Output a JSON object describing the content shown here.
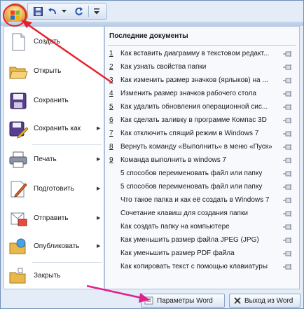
{
  "quick_access": {
    "icons": [
      "office-button-icon",
      "save-icon",
      "undo-icon",
      "redo-icon",
      "customize-dropdown-icon"
    ]
  },
  "menu": {
    "commands": [
      {
        "label": "Создать",
        "icon": "new-document-icon",
        "submenu": false
      },
      {
        "label": "Открыть",
        "icon": "open-folder-icon",
        "submenu": false
      },
      {
        "label": "Сохранить",
        "icon": "save-icon",
        "submenu": false
      },
      {
        "label": "Сохранить как",
        "icon": "save-as-icon",
        "submenu": true
      },
      {
        "label": "Печать",
        "icon": "print-icon",
        "submenu": true
      },
      {
        "label": "Подготовить",
        "icon": "prepare-icon",
        "submenu": true
      },
      {
        "label": "Отправить",
        "icon": "send-icon",
        "submenu": true
      },
      {
        "label": "Опубликовать",
        "icon": "publish-icon",
        "submenu": true
      },
      {
        "label": "Закрыть",
        "icon": "close-folder-icon",
        "submenu": false
      }
    ]
  },
  "recent": {
    "title": "Последние документы",
    "items": [
      {
        "num": "1",
        "text": "Как вставить диаграмму в текстовом редакт..."
      },
      {
        "num": "2",
        "text": "Как узнать свойства папки"
      },
      {
        "num": "3",
        "text": "Как изменить размер значков (ярлыков) на ..."
      },
      {
        "num": "4",
        "text": "Изменить размер значков рабочего стола"
      },
      {
        "num": "5",
        "text": "Как удалить обновления операционной сис..."
      },
      {
        "num": "6",
        "text": "Как сделать заливку в программе Компас 3D"
      },
      {
        "num": "7",
        "text": "Как отключить спящий режим в Windows 7"
      },
      {
        "num": "8",
        "text": "Вернуть команду «Выполнить» в меню «Пуск»"
      },
      {
        "num": "9",
        "text": "Команда выполнить в windows 7"
      },
      {
        "num": "",
        "text": "5 способов переименовать файл или папку"
      },
      {
        "num": "",
        "text": "5 способов переименовать файл или папку"
      },
      {
        "num": "",
        "text": "Что такое папка и как её создать в Windows 7"
      },
      {
        "num": "",
        "text": "Сочетание клавиш для создания папки"
      },
      {
        "num": "",
        "text": "Как создать папку на компьютере"
      },
      {
        "num": "",
        "text": "Как уменьшить размер файла JPEG (JPG)"
      },
      {
        "num": "",
        "text": "Как уменьшить размер PDF файла"
      },
      {
        "num": "",
        "text": "Как копировать текст с помощью клавиатуры"
      }
    ]
  },
  "footer": {
    "options_label": "Параметры Word",
    "exit_label": "Выход из Word"
  },
  "colors": {
    "annotation_arrow_red": "#e8202a",
    "annotation_arrow_magenta": "#e0208c"
  }
}
